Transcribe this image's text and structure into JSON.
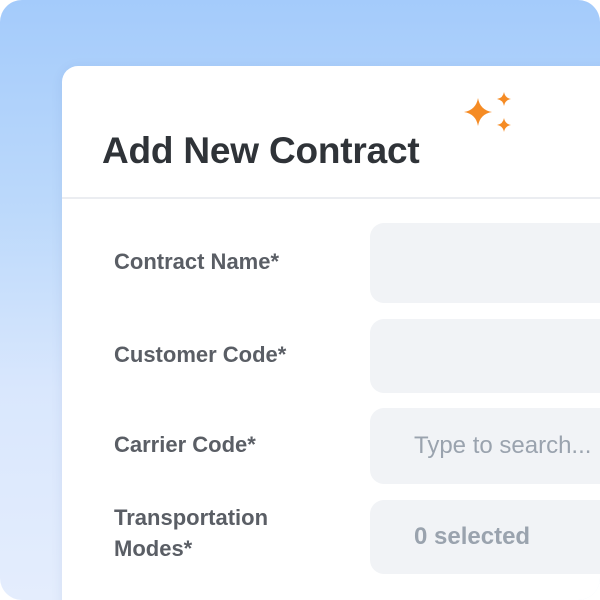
{
  "dialog": {
    "title": "Add New Contract",
    "accent_color": "#f58b24"
  },
  "form": {
    "contract_name": {
      "label": "Contract Name*",
      "value": ""
    },
    "customer_code": {
      "label": "Customer Code*",
      "value": ""
    },
    "carrier_code": {
      "label": "Carrier Code*",
      "placeholder": "Type to search..."
    },
    "transportation_modes": {
      "label_line1": "Transportation",
      "label_line2": "Modes*",
      "value": "0 selected"
    }
  },
  "icons": {
    "title_decoration": "sparkles-icon"
  }
}
